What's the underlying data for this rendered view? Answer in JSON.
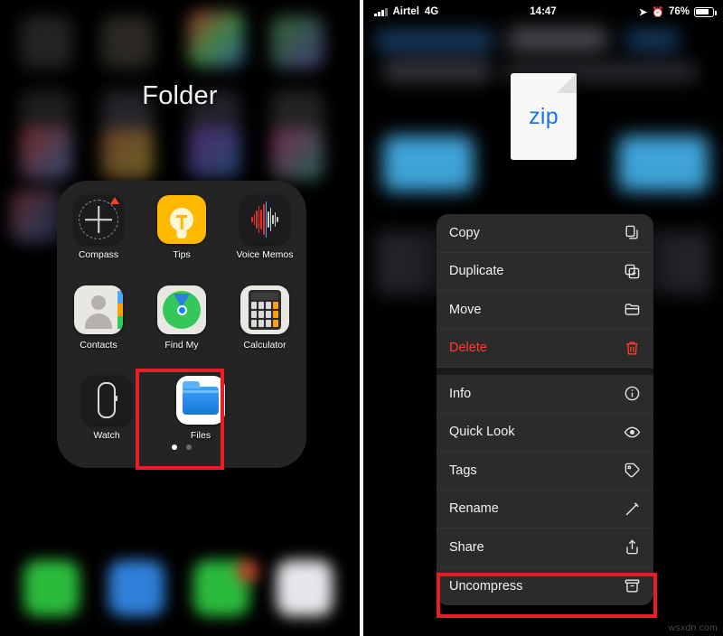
{
  "left_panel": {
    "folder_title": "Folder",
    "apps": [
      [
        {
          "label": "Compass",
          "icon": "compass-icon"
        },
        {
          "label": "Tips",
          "icon": "tips-icon"
        },
        {
          "label": "Voice Memos",
          "icon": "voice-memos-icon"
        }
      ],
      [
        {
          "label": "Contacts",
          "icon": "contacts-icon"
        },
        {
          "label": "Find My",
          "icon": "find-my-icon"
        },
        {
          "label": "Calculator",
          "icon": "calculator-icon"
        }
      ],
      [
        {
          "label": "Watch",
          "icon": "watch-icon"
        },
        {
          "label": "Files",
          "icon": "files-icon"
        }
      ]
    ],
    "page_dots": {
      "count": 2,
      "active_index": 0
    },
    "highlight": {
      "target": "Files",
      "color": "#ed1c24"
    }
  },
  "right_panel": {
    "status_bar": {
      "carrier": "Airtel",
      "network": "4G",
      "time": "14:47",
      "battery_percent": "76%",
      "icons": [
        "signal-icon",
        "location-icon",
        "alarm-icon",
        "battery-icon"
      ]
    },
    "file_preview": {
      "type_label": "zip",
      "icon": "zip-document-icon"
    },
    "context_menu": {
      "groups": [
        [
          {
            "label": "Copy",
            "icon": "copy-icon",
            "destructive": false
          },
          {
            "label": "Duplicate",
            "icon": "duplicate-icon",
            "destructive": false
          },
          {
            "label": "Move",
            "icon": "folder-icon",
            "destructive": false
          },
          {
            "label": "Delete",
            "icon": "trash-icon",
            "destructive": true
          }
        ],
        [
          {
            "label": "Info",
            "icon": "info-circle-icon",
            "destructive": false
          },
          {
            "label": "Quick Look",
            "icon": "eye-icon",
            "destructive": false
          },
          {
            "label": "Tags",
            "icon": "tag-icon",
            "destructive": false
          },
          {
            "label": "Rename",
            "icon": "pencil-icon",
            "destructive": false
          },
          {
            "label": "Share",
            "icon": "share-icon",
            "destructive": false
          },
          {
            "label": "Uncompress",
            "icon": "archive-box-icon",
            "destructive": false
          }
        ]
      ],
      "highlight": {
        "target": "Uncompress",
        "color": "#ed1c24"
      }
    }
  },
  "watermark": "wsxdn.com",
  "colors": {
    "highlight_red": "#ed1c24",
    "menu_bg": "#2b2b2b",
    "destructive": "#ff3b30",
    "zip_text": "#1a73e8",
    "files_blue": "#1777d8",
    "tips_yellow": "#ffb800"
  }
}
